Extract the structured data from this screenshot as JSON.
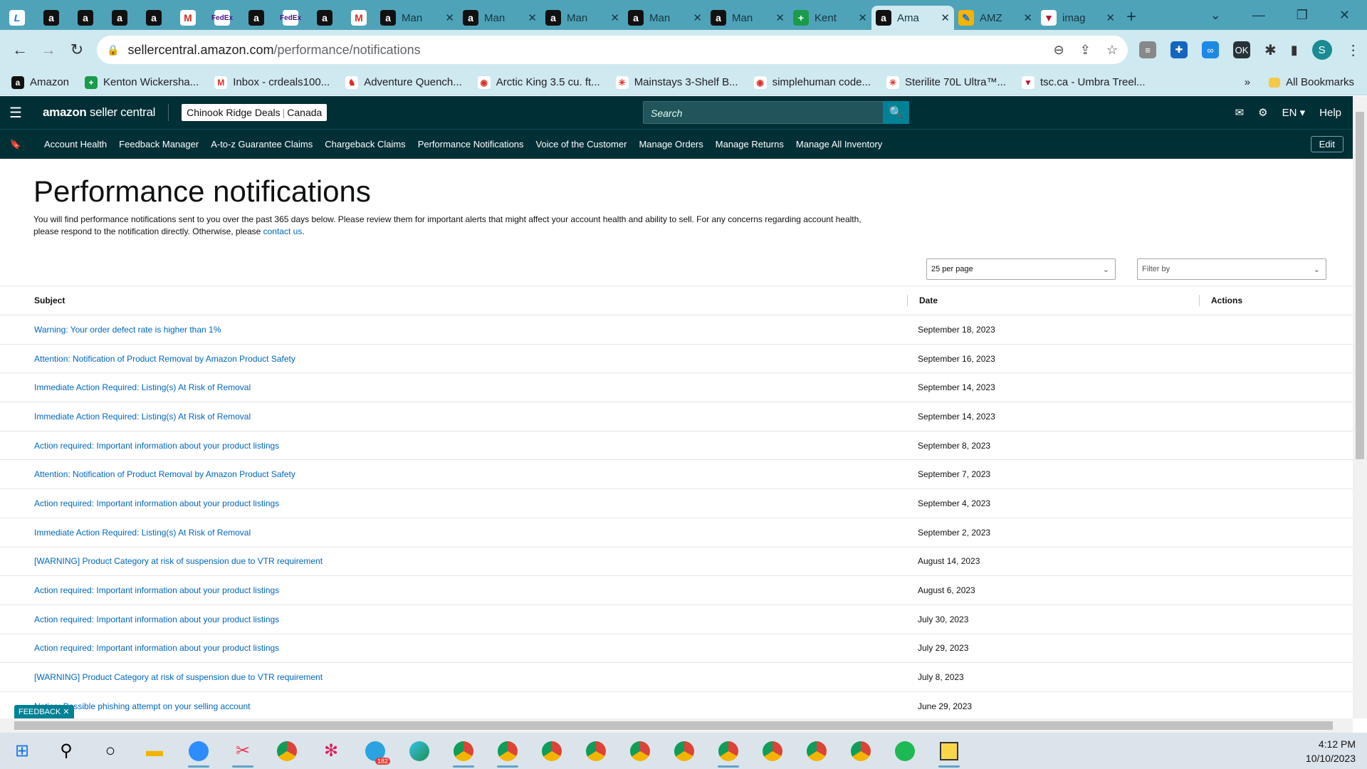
{
  "browser": {
    "tabs": [
      {
        "icon": "lightspeed-icon",
        "label": ""
      },
      {
        "icon": "amazon-icon",
        "label": ""
      },
      {
        "icon": "amazon-icon",
        "label": ""
      },
      {
        "icon": "amazon-icon",
        "label": ""
      },
      {
        "icon": "amazon-icon",
        "label": ""
      },
      {
        "icon": "gmail-icon",
        "label": ""
      },
      {
        "icon": "fedex-icon",
        "label": ""
      },
      {
        "icon": "amazon-icon",
        "label": ""
      },
      {
        "icon": "fedex-icon",
        "label": ""
      },
      {
        "icon": "amazon-icon",
        "label": ""
      },
      {
        "icon": "gmail-icon",
        "label": ""
      },
      {
        "icon": "amazon-icon",
        "label": "Man"
      },
      {
        "icon": "amazon-icon",
        "label": "Man"
      },
      {
        "icon": "amazon-icon",
        "label": "Man"
      },
      {
        "icon": "amazon-icon",
        "label": "Man"
      },
      {
        "icon": "amazon-icon",
        "label": "Man"
      },
      {
        "icon": "sheets-icon",
        "label": "Kent"
      },
      {
        "icon": "amazon-icon",
        "label": "Ama"
      },
      {
        "icon": "pencil-icon",
        "label": "AMZ"
      },
      {
        "icon": "tsc-icon",
        "label": "imag"
      }
    ],
    "url_host": "sellercentral.amazon.com",
    "url_path": "/performance/notifications",
    "profile_initial": "S",
    "bookmarks": [
      {
        "icon": "amazon-icon",
        "label": "Amazon"
      },
      {
        "icon": "sheets-icon",
        "label": "Kenton Wickersha..."
      },
      {
        "icon": "gmail-icon",
        "label": "Inbox - crdeals100..."
      },
      {
        "icon": "moose-icon",
        "label": "Adventure Quench..."
      },
      {
        "icon": "globe-icon",
        "label": "Arctic King 3.5 cu. ft..."
      },
      {
        "icon": "walmart-icon",
        "label": "Mainstays 3-Shelf B..."
      },
      {
        "icon": "globe-icon",
        "label": "simplehuman code..."
      },
      {
        "icon": "walmart-icon",
        "label": "Sterilite 70L Ultra™..."
      },
      {
        "icon": "tsc-icon",
        "label": "tsc.ca - Umbra Treel..."
      }
    ],
    "all_bookmarks": "All Bookmarks"
  },
  "header": {
    "logo_bold": "amazon",
    "logo_rest": " seller central",
    "account_name": "Chinook Ridge Deals",
    "account_region": "Canada",
    "search_placeholder": "Search",
    "language": "EN",
    "help": "Help"
  },
  "nav": {
    "items": [
      "Account Health",
      "Feedback Manager",
      "A-to-z Guarantee Claims",
      "Chargeback Claims",
      "Performance Notifications",
      "Voice of the Customer",
      "Manage Orders",
      "Manage Returns",
      "Manage All Inventory"
    ],
    "edit": "Edit"
  },
  "page": {
    "title": "Performance notifications",
    "description_1": "You will find performance notifications sent to you over the past 365 days below. Please review them for important alerts that might affect your account health and ability to sell. For any concerns regarding account health, please respond to the notification directly. Otherwise, please ",
    "contact_link": "contact us",
    "description_end": ".",
    "per_page": "25 per page",
    "filter_placeholder": "Filter by"
  },
  "table": {
    "headers": {
      "subject": "Subject",
      "date": "Date",
      "actions": "Actions"
    },
    "rows": [
      {
        "subject": "Warning: Your order defect rate is higher than 1%",
        "date": "September 18, 2023"
      },
      {
        "subject": "Attention: Notification of Product Removal by Amazon Product Safety",
        "date": "September 16, 2023"
      },
      {
        "subject": "Immediate Action Required: Listing(s) At Risk of Removal",
        "date": "September 14, 2023"
      },
      {
        "subject": "Immediate Action Required: Listing(s) At Risk of Removal",
        "date": "September 14, 2023"
      },
      {
        "subject": "Action required: Important information about your product listings",
        "date": "September 8, 2023"
      },
      {
        "subject": "Attention: Notification of Product Removal by Amazon Product Safety",
        "date": "September 7, 2023"
      },
      {
        "subject": "Action required: Important information about your product listings",
        "date": "September 4, 2023"
      },
      {
        "subject": "Immediate Action Required: Listing(s) At Risk of Removal",
        "date": "September 2, 2023"
      },
      {
        "subject": "[WARNING] Product Category at risk of suspension due to VTR requirement",
        "date": "August 14, 2023"
      },
      {
        "subject": "Action required: Important information about your product listings",
        "date": "August 6, 2023"
      },
      {
        "subject": "Action required: Important information about your product listings",
        "date": "July 30, 2023"
      },
      {
        "subject": "Action required: Important information about your product listings",
        "date": "July 29, 2023"
      },
      {
        "subject": "[WARNING] Product Category at risk of suspension due to VTR requirement",
        "date": "July 8, 2023"
      },
      {
        "subject": "Notice: Possible phishing attempt on your selling account",
        "date": "June 29, 2023"
      }
    ]
  },
  "feedback": "FEEDBACK",
  "taskbar": {
    "time": "4:12 PM",
    "date": "10/10/2023",
    "telegram_badge": "182"
  }
}
